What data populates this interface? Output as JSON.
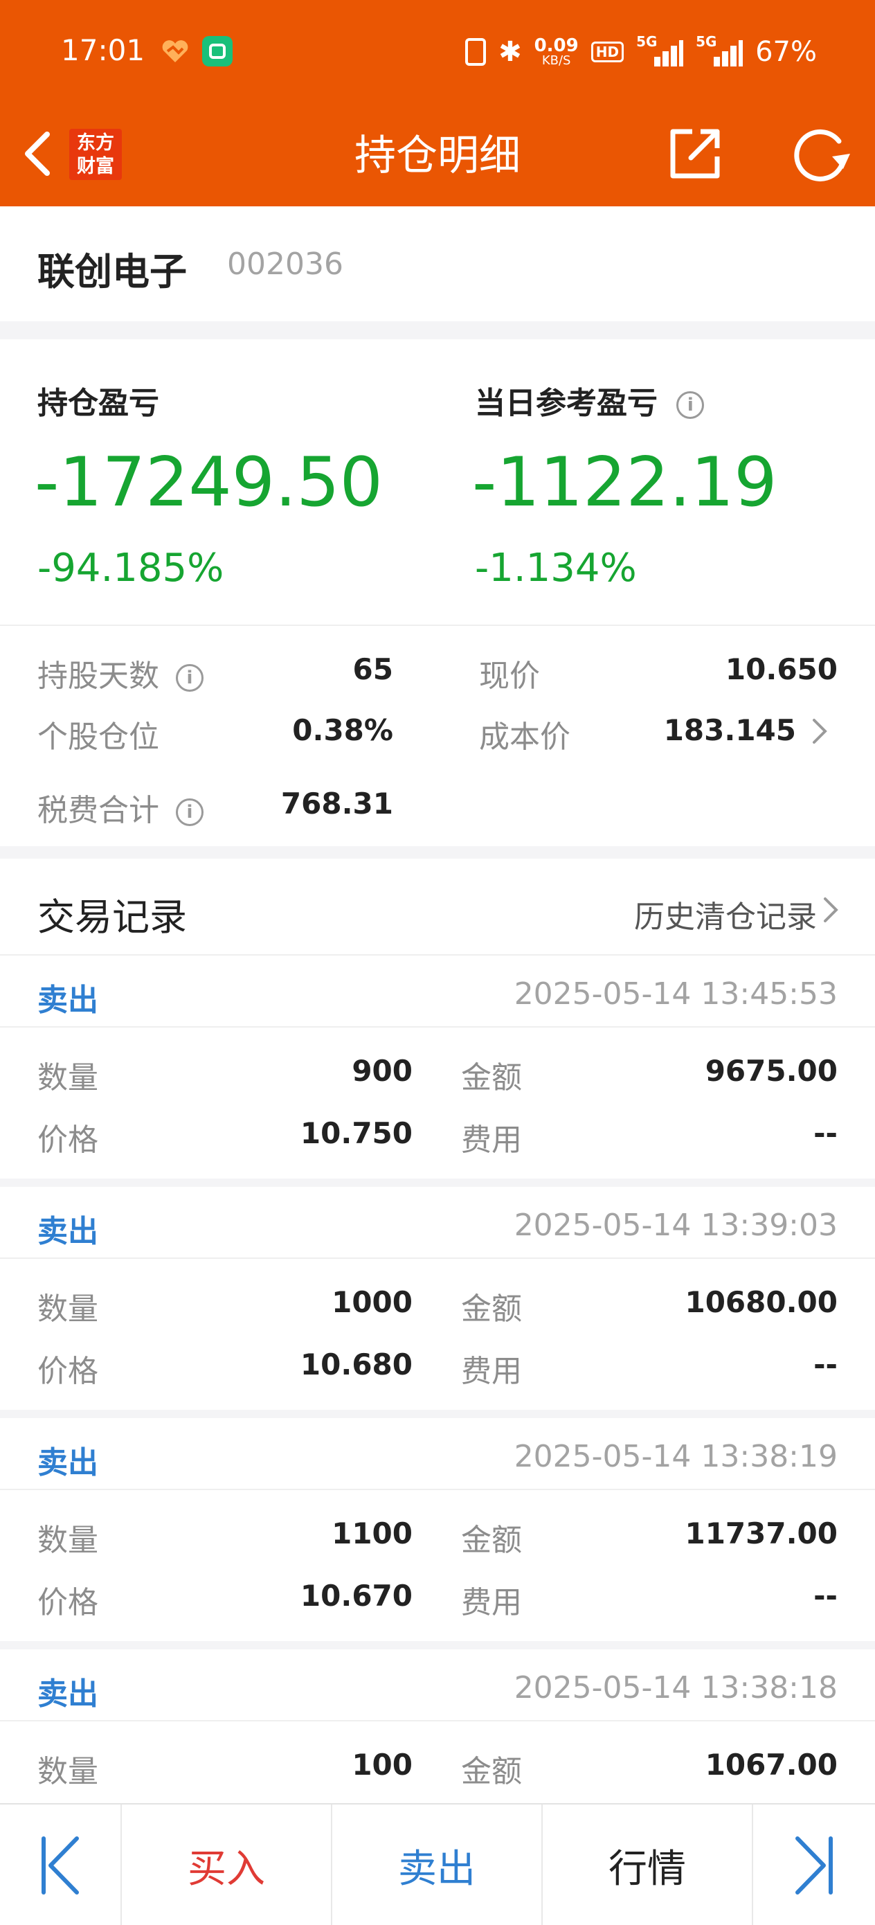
{
  "status_bar": {
    "time": "17:01",
    "net_speed": "0.09",
    "net_speed_unit": "KB/S",
    "hd_label": "HD",
    "signal1_label": "5G",
    "signal2_label": "5G",
    "battery": "67%"
  },
  "nav": {
    "logo_line1": "东方",
    "logo_line2": "财富",
    "title": "持仓明细"
  },
  "stock": {
    "name": "联创电子",
    "code": "002036"
  },
  "summary": {
    "holding_pl_label": "持仓盈亏",
    "holding_pl_value": "-17249.50",
    "holding_pl_pct": "-94.185%",
    "daily_pl_label": "当日参考盈亏",
    "daily_pl_value": "-1122.19",
    "daily_pl_pct": "-1.134%",
    "stats": {
      "days_label": "持股天数",
      "days_value": "65",
      "price_label": "现价",
      "price_value": "10.650",
      "position_label": "个股仓位",
      "position_value": "0.38%",
      "cost_label": "成本价",
      "cost_value": "183.145",
      "fees_label": "税费合计",
      "fees_value": "768.31"
    }
  },
  "trades": {
    "title": "交易记录",
    "history_link": "历史清仓记录",
    "labels": {
      "qty": "数量",
      "amount": "金额",
      "price": "价格",
      "fee": "费用"
    },
    "records": [
      {
        "type": "卖出",
        "time": "2025-05-14 13:45:53",
        "qty": "900",
        "amount": "9675.00",
        "price": "10.750",
        "fee": "--"
      },
      {
        "type": "卖出",
        "time": "2025-05-14 13:39:03",
        "qty": "1000",
        "amount": "10680.00",
        "price": "10.680",
        "fee": "--"
      },
      {
        "type": "卖出",
        "time": "2025-05-14 13:38:19",
        "qty": "1100",
        "amount": "11737.00",
        "price": "10.670",
        "fee": "--"
      },
      {
        "type": "卖出",
        "time": "2025-05-14 13:38:18",
        "qty": "100",
        "amount": "1067.00",
        "price": "",
        "fee": ""
      }
    ]
  },
  "bottom_bar": {
    "buy_label": "买入",
    "sell_label": "卖出",
    "quote_label": "行情"
  },
  "colors": {
    "brand_orange": "#ea5603",
    "loss_green": "#16a531",
    "sell_blue": "#2f7fd1",
    "buy_red": "#e03b35"
  },
  "icons": [
    "back-icon",
    "share-icon",
    "refresh-icon",
    "info-icon",
    "chevron-right-icon",
    "first-page-icon",
    "last-page-icon"
  ]
}
